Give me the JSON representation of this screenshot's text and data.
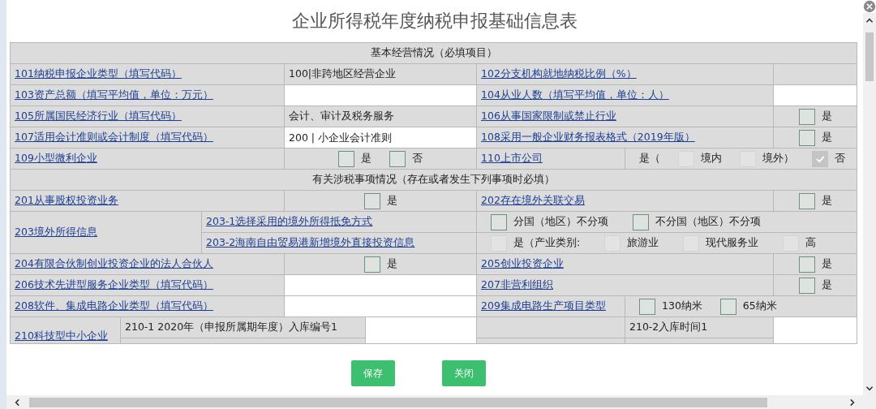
{
  "dialog": {
    "title": "企业所得税年度纳税申报基础信息表"
  },
  "sections": [
    {
      "heading": "基本经营情况（必填项目）",
      "rows": [
        {
          "kind": "pair",
          "left": {
            "label": "101纳税申报企业类型（填写代码）",
            "value": {
              "kind": "text",
              "text": "100|非跨地区经营企业"
            }
          },
          "right": {
            "label": "102分支机构就地纳税比例（%）",
            "value": {
              "kind": "blank"
            }
          }
        },
        {
          "kind": "pair",
          "left": {
            "label": "103资产总额（填写平均值，单位：万元）",
            "value": {
              "kind": "input"
            }
          },
          "right": {
            "label": "104从业人数（填写平均值，单位：人）",
            "value": {
              "kind": "input"
            }
          }
        },
        {
          "kind": "pair",
          "left": {
            "label": "105所属国民经济行业（填写代码）",
            "value": {
              "kind": "text",
              "text": "会计、审计及税务服务"
            }
          },
          "right": {
            "label": "106从事国家限制或禁止行业",
            "value": {
              "kind": "options",
              "items": [
                {
                  "kind": "check",
                  "label": "是",
                  "checked": false,
                  "disabled": false
                }
              ]
            }
          }
        },
        {
          "kind": "pair",
          "left": {
            "label": "107适用会计准则或会计制度（填写代码）",
            "value": {
              "kind": "input",
              "value": "200 | 小企业会计准则"
            }
          },
          "right": {
            "label": "108采用一般企业财务报表格式（2019年版）",
            "value": {
              "kind": "options",
              "items": [
                {
                  "kind": "check",
                  "label": "是",
                  "checked": false,
                  "disabled": false
                }
              ]
            }
          }
        },
        {
          "kind": "pair_wide",
          "left": {
            "label": "109小型微利企业",
            "value": {
              "kind": "options",
              "items": [
                {
                  "kind": "check",
                  "label": "是",
                  "checked": false,
                  "disabled": false
                },
                {
                  "kind": "check",
                  "label": "否",
                  "checked": false,
                  "disabled": false
                }
              ]
            }
          },
          "right": {
            "label": "110上市公司",
            "value": {
              "kind": "options",
              "items": [
                {
                  "kind": "text",
                  "label": "是（"
                },
                {
                  "kind": "check",
                  "label": "境内",
                  "checked": false,
                  "disabled": true
                },
                {
                  "kind": "check",
                  "label": "境外）",
                  "checked": false,
                  "disabled": true
                },
                {
                  "kind": "check",
                  "label": "否",
                  "checked": true,
                  "disabled": true
                }
              ]
            }
          }
        }
      ]
    },
    {
      "heading": "有关涉税事项情况（存在或者发生下列事项时必填）",
      "rows": [
        {
          "kind": "pair",
          "left": {
            "label": "201从事股权投资业务",
            "value": {
              "kind": "options",
              "items": [
                {
                  "kind": "check",
                  "label": "是",
                  "checked": false,
                  "disabled": false
                }
              ]
            }
          },
          "right": {
            "label": "202存在境外关联交易",
            "value": {
              "kind": "options",
              "items": [
                {
                  "kind": "check",
                  "label": "是",
                  "checked": false,
                  "disabled": false
                }
              ]
            }
          }
        },
        {
          "kind": "group",
          "label": "203境外所得信息",
          "subs": [
            {
              "label": "203-1选择采用的境外所得抵免方式",
              "value": {
                "kind": "options",
                "items": [
                  {
                    "kind": "check",
                    "label": "分国（地区）不分项",
                    "checked": false,
                    "disabled": false
                  },
                  {
                    "kind": "check",
                    "label": "不分国（地区）不分项",
                    "checked": false,
                    "disabled": false
                  }
                ]
              }
            },
            {
              "label": "203-2海南自由贸易港新增境外直接投资信息",
              "value": {
                "kind": "options",
                "items": [
                  {
                    "kind": "check",
                    "label": "是（产业类别:",
                    "checked": false,
                    "disabled": true
                  },
                  {
                    "kind": "check",
                    "label": "旅游业",
                    "checked": false,
                    "disabled": true
                  },
                  {
                    "kind": "check",
                    "label": "现代服务业",
                    "checked": false,
                    "disabled": true
                  },
                  {
                    "kind": "check",
                    "label": "高",
                    "checked": false,
                    "disabled": true
                  }
                ]
              }
            }
          ]
        },
        {
          "kind": "pair",
          "left": {
            "label": "204有限合伙制创业投资企业的法人合伙人",
            "value": {
              "kind": "options",
              "items": [
                {
                  "kind": "check",
                  "label": "是",
                  "checked": false,
                  "disabled": false
                }
              ]
            }
          },
          "right": {
            "label": "205创业投资企业",
            "value": {
              "kind": "options",
              "items": [
                {
                  "kind": "check",
                  "label": "是",
                  "checked": false,
                  "disabled": false
                }
              ]
            }
          }
        },
        {
          "kind": "pair",
          "left": {
            "label": "206技术先进型服务企业类型（填写代码）",
            "value": {
              "kind": "input"
            }
          },
          "right": {
            "label": "207非营利组织",
            "value": {
              "kind": "options",
              "items": [
                {
                  "kind": "check",
                  "label": "是",
                  "checked": false,
                  "disabled": false
                }
              ]
            }
          }
        },
        {
          "kind": "pair_wide",
          "left": {
            "label": "208软件、集成电路企业类型（填写代码）",
            "value": {
              "kind": "input"
            }
          },
          "right": {
            "label": "209集成电路生产项目类型",
            "value": {
              "kind": "options",
              "items": [
                {
                  "kind": "check",
                  "label": "130纳米",
                  "checked": false,
                  "disabled": false
                },
                {
                  "kind": "check",
                  "label": "65纳米",
                  "checked": false,
                  "disabled": false
                }
              ]
            }
          }
        },
        {
          "kind": "split",
          "label": "210科技型中小企业",
          "first": "210-1  2020年（申报所属期年度）入库编号1",
          "second": "210-2入库时间1"
        }
      ]
    }
  ],
  "buttons": [
    {
      "label": "保存"
    },
    {
      "label": "关闭"
    }
  ]
}
